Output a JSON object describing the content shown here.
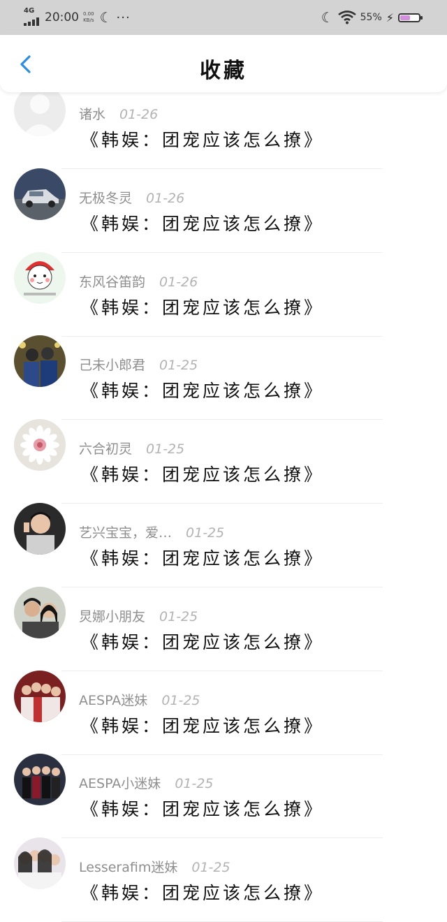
{
  "status_bar": {
    "network": "4G",
    "time": "20:00",
    "speed_value": "0.00",
    "speed_unit": "KB/s",
    "more": "···",
    "battery_percent": "55%",
    "battery_level": 0.55
  },
  "header": {
    "title": "收藏"
  },
  "items": [
    {
      "name": "诸水",
      "date": "01-26",
      "title": "《韩娱：团宠应该怎么撩》",
      "avatar": "placeholder"
    },
    {
      "name": "无极冬灵",
      "date": "01-26",
      "title": "《韩娱：团宠应该怎么撩》",
      "avatar": "car"
    },
    {
      "name": "东风谷笛韵",
      "date": "01-26",
      "title": "《韩娱：团宠应该怎么撩》",
      "avatar": "cartoon"
    },
    {
      "name": "己未小郎君",
      "date": "01-25",
      "title": "《韩娱：团宠应该怎么撩》",
      "avatar": "people-dark"
    },
    {
      "name": "六合初灵",
      "date": "01-25",
      "title": "《韩娱：团宠应该怎么撩》",
      "avatar": "flower"
    },
    {
      "name": "艺兴宝宝，爱…",
      "date": "01-25",
      "title": "《韩娱：团宠应该怎么撩》",
      "avatar": "person-photo"
    },
    {
      "name": "炅娜小朋友",
      "date": "01-25",
      "title": "《韩娱：团宠应该怎么撩》",
      "avatar": "couple"
    },
    {
      "name": "AESPA迷妹",
      "date": "01-25",
      "title": "《韩娱：团宠应该怎么撩》",
      "avatar": "group-red"
    },
    {
      "name": "AESPA小迷妹",
      "date": "01-25",
      "title": "《韩娱：团宠应该怎么撩》",
      "avatar": "group-stage"
    },
    {
      "name": "Lesserafim迷妹",
      "date": "01-25",
      "title": "《韩娱：团宠应该怎么撩》",
      "avatar": "group-light"
    }
  ],
  "colors": {
    "accent": "#2b8ee6",
    "name_text": "#8e8e8e",
    "date_text": "#b3b3b3",
    "title_text": "#111111"
  }
}
